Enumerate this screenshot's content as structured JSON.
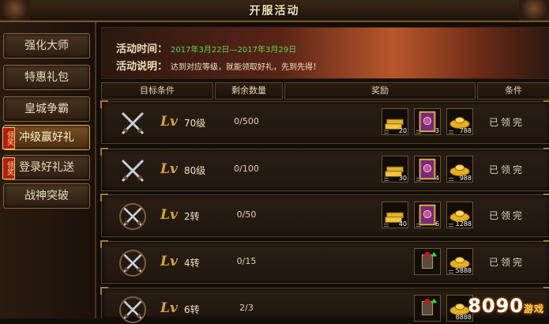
{
  "window": {
    "title": "开服活动"
  },
  "sidebar": {
    "items": [
      {
        "label": "强化大师",
        "active": false,
        "badge": ""
      },
      {
        "label": "特惠礼包",
        "active": false,
        "badge": ""
      },
      {
        "label": "皇城争霸",
        "active": false,
        "badge": ""
      },
      {
        "label": "冲级赢好礼",
        "active": true,
        "badge": "领奖"
      },
      {
        "label": "登录好礼送",
        "active": false,
        "badge": "领奖"
      },
      {
        "label": "战神突破",
        "active": false,
        "badge": ""
      }
    ]
  },
  "banner": {
    "time_label": "活动时间：",
    "time_value": "2017年3月22日—2017年3月29日",
    "desc_label": "活动说明：",
    "desc_value": "达到对应等级，就能领取好礼，先到先得！"
  },
  "table": {
    "headers": [
      "目标条件",
      "剩余数量",
      "奖励",
      "条件"
    ],
    "rows": [
      {
        "lv_prefix": "Lv",
        "level": "70级",
        "remaining": "0/500",
        "rewards": [
          {
            "icon": "gold-bars-icon",
            "count": "20"
          },
          {
            "icon": "skill-book-icon",
            "count": "3"
          },
          {
            "icon": "ingot-icon",
            "count": "788"
          }
        ],
        "status": "已领完"
      },
      {
        "lv_prefix": "Lv",
        "level": "80级",
        "remaining": "0/100",
        "rewards": [
          {
            "icon": "gold-bars-icon",
            "count": "30"
          },
          {
            "icon": "skill-book-icon",
            "count": "4"
          },
          {
            "icon": "ingot-icon",
            "count": "988"
          }
        ],
        "status": "已领完"
      },
      {
        "lv_prefix": "Lv",
        "level": "2转",
        "remaining": "0/50",
        "rewards": [
          {
            "icon": "gold-bars-icon",
            "count": "40"
          },
          {
            "icon": "skill-book-icon",
            "count": "6"
          },
          {
            "icon": "ingot-icon",
            "count": "1288"
          }
        ],
        "status": "已领完"
      },
      {
        "lv_prefix": "Lv",
        "level": "4转",
        "remaining": "0/15",
        "rewards": [
          {
            "icon": "armor-icon",
            "count": ""
          },
          {
            "icon": "ingot-icon",
            "count": "5888"
          }
        ],
        "status": "已领完"
      },
      {
        "lv_prefix": "Lv",
        "level": "6转",
        "remaining": "2/3",
        "rewards": [
          {
            "icon": "armor-icon",
            "count": ""
          },
          {
            "icon": "ingot-icon",
            "count": "8888"
          }
        ],
        "status": ""
      }
    ]
  },
  "watermark": {
    "text": "8090",
    "sub": "游戏"
  },
  "colors": {
    "accent": "#d8a53a",
    "time_text": "#56d84a",
    "banner_red": "#b8572c"
  }
}
